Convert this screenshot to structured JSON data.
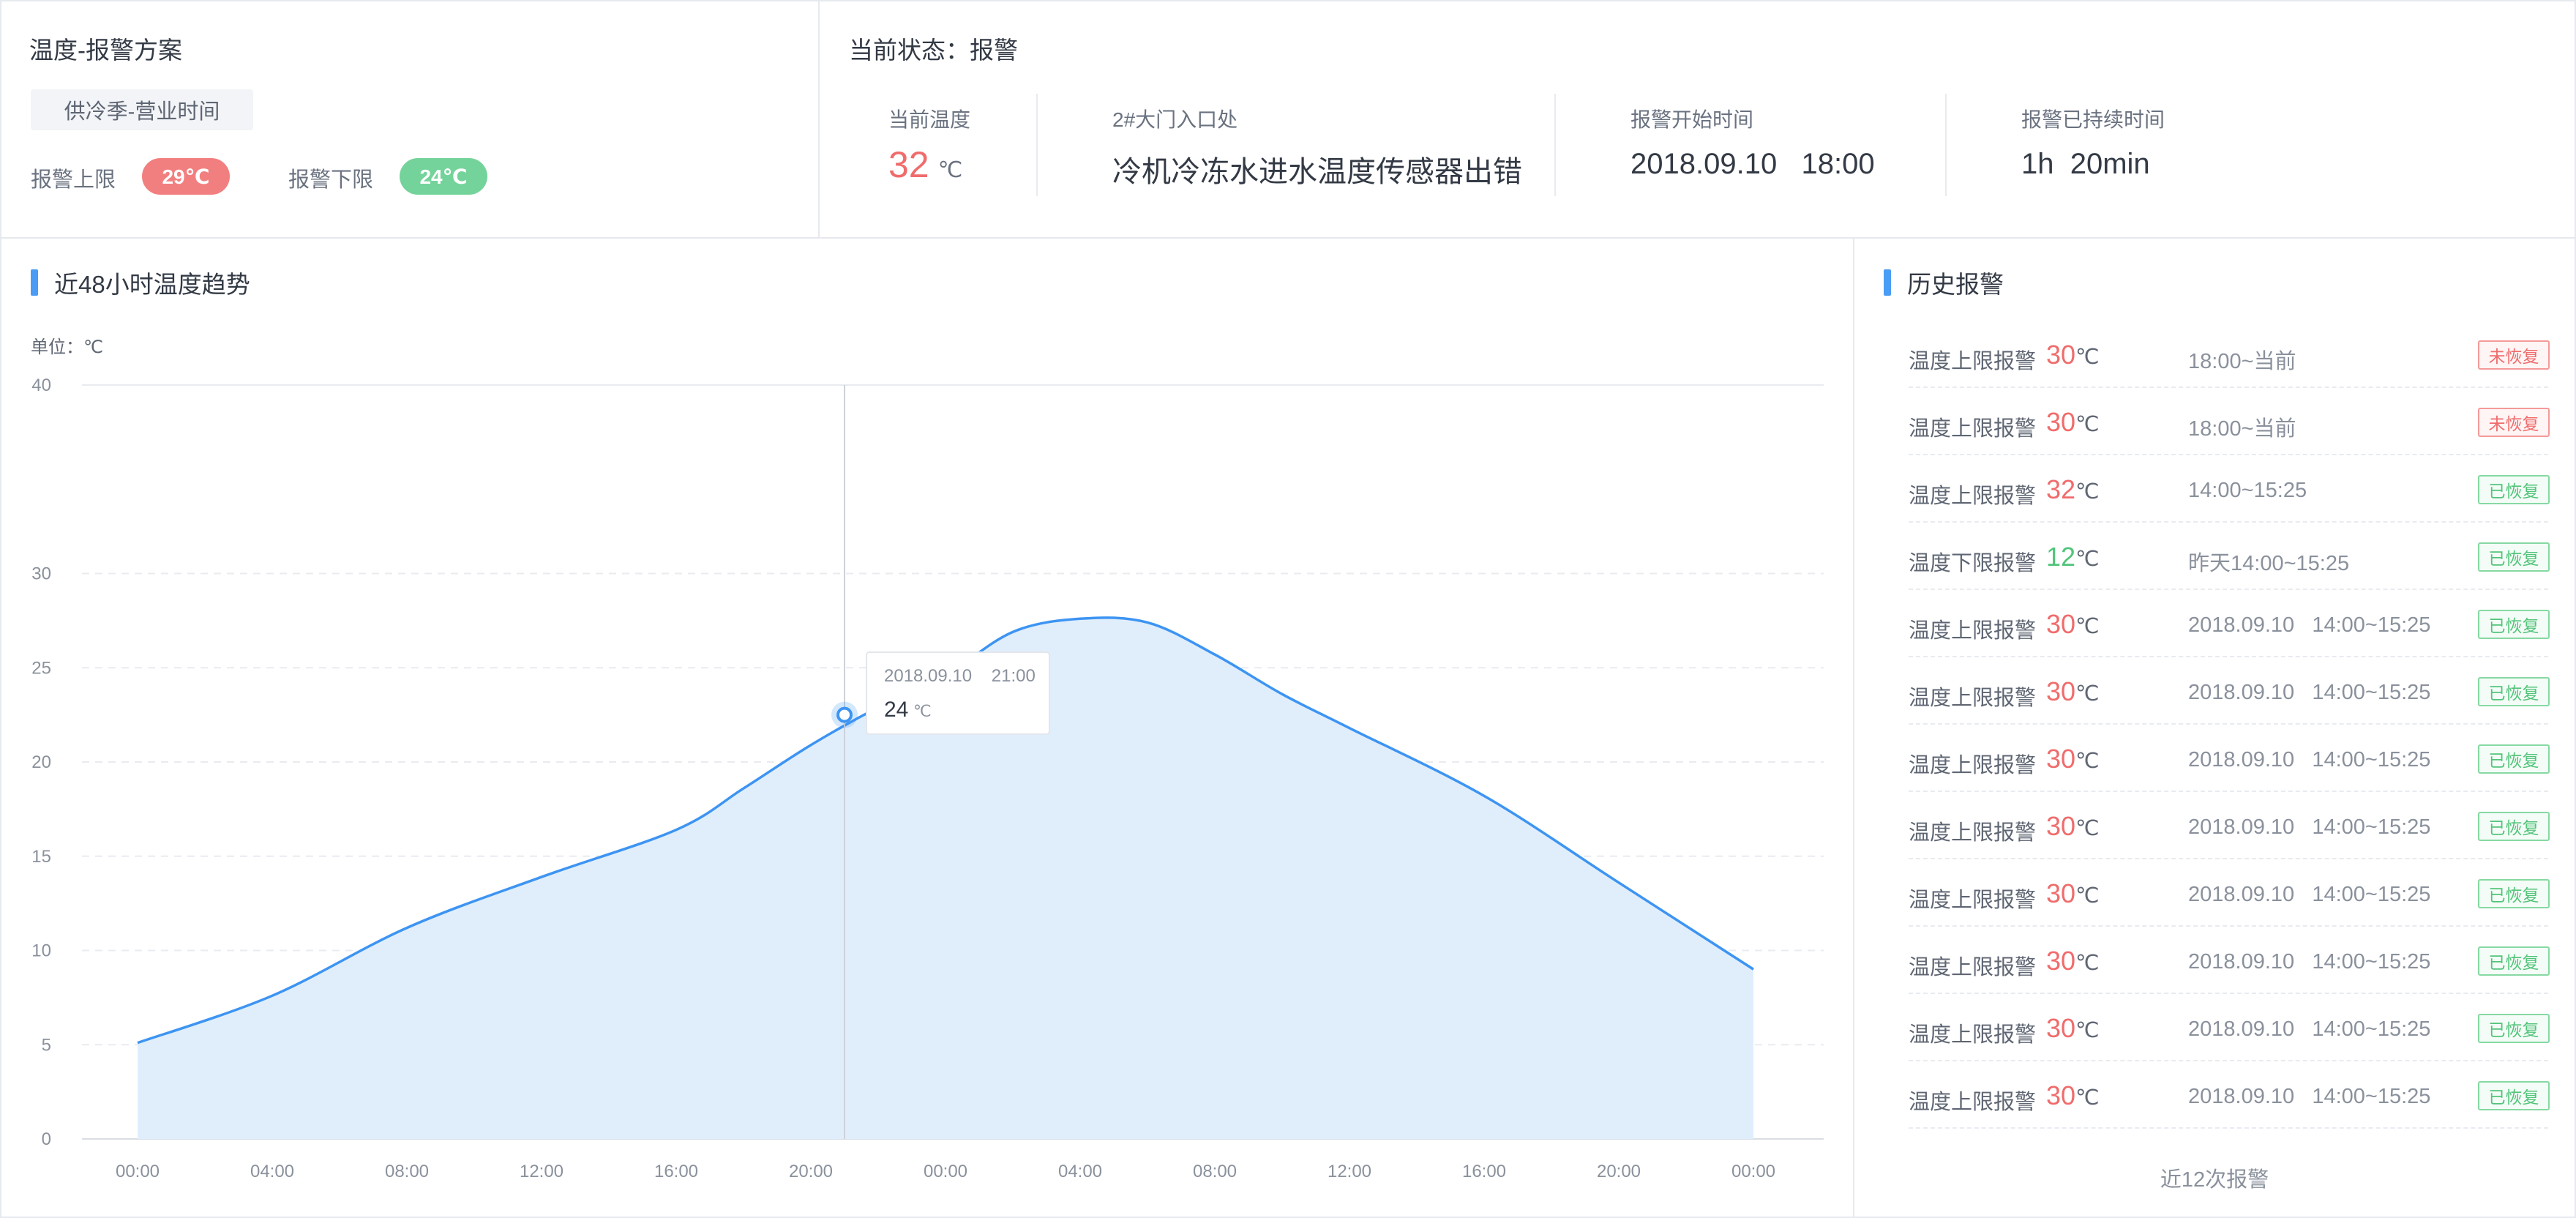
{
  "plan": {
    "title": "温度-报警方案",
    "chip": "供冷季-营业时间",
    "upper_label": "报警上限",
    "upper_value": "29℃",
    "lower_label": "报警下限",
    "lower_value": "24℃"
  },
  "status": {
    "title": "当前状态：报警",
    "current_temp_label": "当前温度",
    "current_temp_value": "32",
    "current_temp_unit": "℃",
    "location_label": "2#大门入口处",
    "location_value": "冷机冷冻水进水温度传感器出错",
    "start_label": "报警开始时间",
    "start_value": "2018.09.10   18:00",
    "duration_label": "报警已持续时间",
    "duration_value": "1h  20min"
  },
  "chart": {
    "title": "近48小时温度趋势",
    "unit_label": "单位：℃",
    "tooltip_time": "2018.09.10    21:00",
    "tooltip_value": "24",
    "tooltip_unit": "℃"
  },
  "chart_data": {
    "type": "area",
    "title": "近48小时温度趋势",
    "ylabel": "单位：℃",
    "ylim": [
      0,
      40
    ],
    "yticks": [
      0,
      5,
      10,
      15,
      20,
      25,
      30,
      40
    ],
    "x_tick_labels": [
      "00:00",
      "04:00",
      "08:00",
      "12:00",
      "16:00",
      "20:00",
      "00:00",
      "04:00",
      "08:00",
      "12:00",
      "16:00",
      "20:00",
      "00:00"
    ],
    "x_hours": [
      0,
      4,
      8,
      12,
      16,
      18,
      20,
      22,
      24,
      26,
      28,
      30,
      32,
      34,
      36,
      40,
      44,
      48
    ],
    "values": [
      5.1,
      7.6,
      11.2,
      13.9,
      16.4,
      18.6,
      20.9,
      22.9,
      24.6,
      26.9,
      27.6,
      27.4,
      25.7,
      23.6,
      21.8,
      18.2,
      13.6,
      9.0
    ],
    "highlight": {
      "label": "2018.09.10    21:00",
      "x_hour": 21,
      "value": 24
    },
    "grid": true,
    "colors": {
      "line": "#3d94f2",
      "fill": "#e0eefc"
    }
  },
  "history": {
    "title": "历史报警",
    "footer": "近12次报警",
    "unit": "℃",
    "rows": [
      {
        "type": "温度上限报警",
        "value": "30",
        "time": "18:00~当前",
        "status": "未恢复",
        "kind": "upper",
        "resolved": false
      },
      {
        "type": "温度上限报警",
        "value": "30",
        "time": "18:00~当前",
        "status": "未恢复",
        "kind": "upper",
        "resolved": false
      },
      {
        "type": "温度上限报警",
        "value": "32",
        "time": "14:00~15:25",
        "status": "已恢复",
        "kind": "upper",
        "resolved": true
      },
      {
        "type": "温度下限报警",
        "value": "12",
        "time": "昨天14:00~15:25",
        "status": "已恢复",
        "kind": "lower",
        "resolved": true
      },
      {
        "type": "温度上限报警",
        "value": "30",
        "time": "2018.09.10   14:00~15:25",
        "status": "已恢复",
        "kind": "upper",
        "resolved": true
      },
      {
        "type": "温度上限报警",
        "value": "30",
        "time": "2018.09.10   14:00~15:25",
        "status": "已恢复",
        "kind": "upper",
        "resolved": true
      },
      {
        "type": "温度上限报警",
        "value": "30",
        "time": "2018.09.10   14:00~15:25",
        "status": "已恢复",
        "kind": "upper",
        "resolved": true
      },
      {
        "type": "温度上限报警",
        "value": "30",
        "time": "2018.09.10   14:00~15:25",
        "status": "已恢复",
        "kind": "upper",
        "resolved": true
      },
      {
        "type": "温度上限报警",
        "value": "30",
        "time": "2018.09.10   14:00~15:25",
        "status": "已恢复",
        "kind": "upper",
        "resolved": true
      },
      {
        "type": "温度上限报警",
        "value": "30",
        "time": "2018.09.10   14:00~15:25",
        "status": "已恢复",
        "kind": "upper",
        "resolved": true
      },
      {
        "type": "温度上限报警",
        "value": "30",
        "time": "2018.09.10   14:00~15:25",
        "status": "已恢复",
        "kind": "upper",
        "resolved": true
      },
      {
        "type": "温度上限报警",
        "value": "30",
        "time": "2018.09.10   14:00~15:25",
        "status": "已恢复",
        "kind": "upper",
        "resolved": true
      }
    ]
  },
  "colors": {
    "accent": "#4a9cf5",
    "alarm_red": "#f06c6c",
    "ok_green": "#52c47a",
    "upper_pill": "#f27f7f",
    "lower_pill": "#74d39a"
  }
}
